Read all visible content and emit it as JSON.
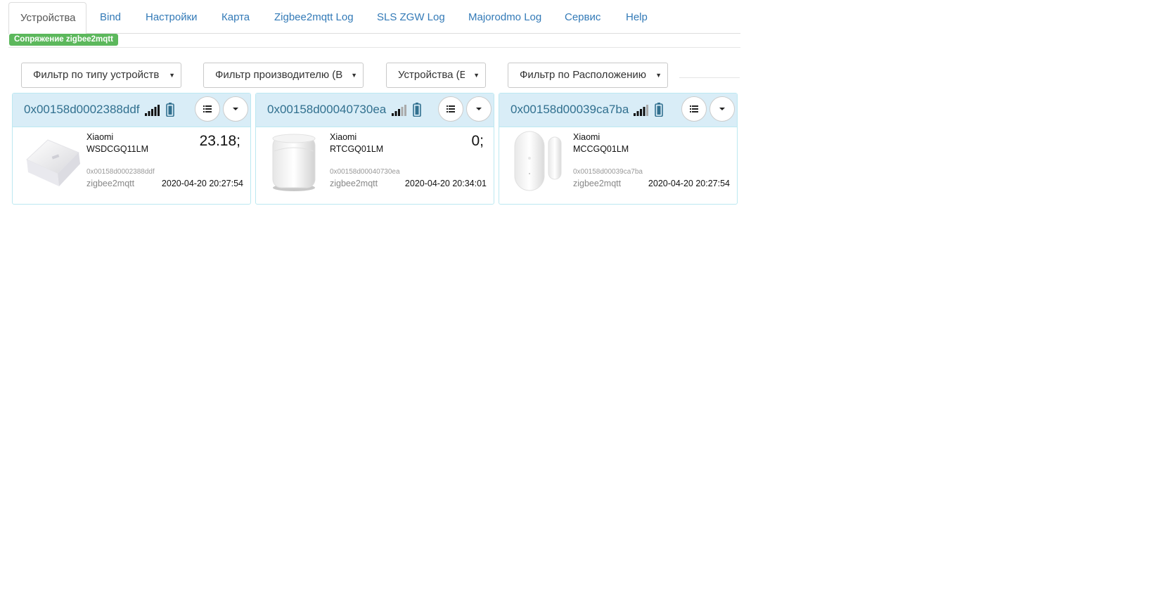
{
  "tabs": [
    {
      "label": "Устройства",
      "active": true
    },
    {
      "label": "Bind"
    },
    {
      "label": "Настройки"
    },
    {
      "label": "Карта"
    },
    {
      "label": "Zigbee2mqtt Log"
    },
    {
      "label": "SLS ZGW Log"
    },
    {
      "label": "Majorodmo Log"
    },
    {
      "label": "Сервис"
    },
    {
      "label": "Help"
    }
  ],
  "pairing_badge": "Сопряжение zigbee2mqtt",
  "filters": {
    "type": "Фильтр по типу устройств",
    "manufacturer": "Фильтр производителю (Вс",
    "devices": "Устройства (Е",
    "location": "Фильтр по Расположению"
  },
  "colors": {
    "accent": "#337ab7",
    "card_header_bg": "#d9edf7",
    "card_border": "#bce8f1",
    "card_title": "#31708f",
    "badge_green": "#5cb85c"
  },
  "icons": {
    "signal": "signal-bars-icon",
    "battery": "battery-icon",
    "list": "list-icon",
    "dropdown": "caret-down-icon"
  },
  "devices": [
    {
      "title": "0x00158d0002388ddf",
      "manufacturer": "Xiaomi",
      "model": "WSDCGQ11LM",
      "value": "23.18;",
      "address": "0x00158d0002388ddf",
      "bridge": "zigbee2mqtt",
      "timestamp": "2020-04-20 20:27:54",
      "signal_bars": 5
    },
    {
      "title": "0x00158d00040730ea",
      "manufacturer": "Xiaomi",
      "model": "RTCGQ01LM",
      "value": "0;",
      "address": "0x00158d00040730ea",
      "bridge": "zigbee2mqtt",
      "timestamp": "2020-04-20 20:34:01",
      "signal_bars": 3
    },
    {
      "title": "0x00158d00039ca7ba",
      "manufacturer": "Xiaomi",
      "model": "MCCGQ01LM",
      "value": "",
      "address": "0x00158d00039ca7ba",
      "bridge": "zigbee2mqtt",
      "timestamp": "2020-04-20 20:27:54",
      "signal_bars": 4
    }
  ]
}
